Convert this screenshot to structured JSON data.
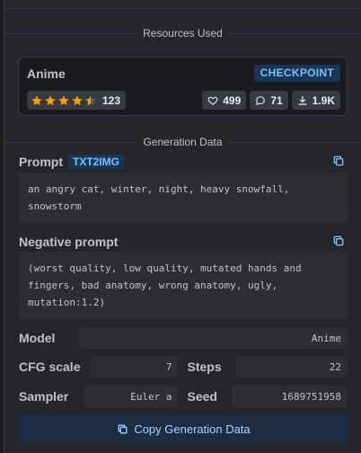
{
  "sections": {
    "resources_title": "Resources Used",
    "generation_title": "Generation Data"
  },
  "resource": {
    "name": "Anime",
    "type_badge": "CHECKPOINT",
    "rating": 4.5,
    "rating_count": "123",
    "likes": "499",
    "comments": "71",
    "downloads": "1.9K"
  },
  "prompt": {
    "label": "Prompt",
    "badge": "TXT2IMG",
    "text": "an angry cat, winter, night, heavy snowfall,\nsnowstorm"
  },
  "negative_prompt": {
    "label": "Negative prompt",
    "text": "(worst quality, low quality, mutated hands and\nfingers, bad anatomy, wrong anatomy, ugly,\nmutation:1.2)"
  },
  "params": {
    "model_label": "Model",
    "model_value": "Anime",
    "cfg_label": "CFG scale",
    "cfg_value": "7",
    "steps_label": "Steps",
    "steps_value": "22",
    "sampler_label": "Sampler",
    "sampler_value": "Euler a",
    "seed_label": "Seed",
    "seed_value": "1689751958"
  },
  "copy_button_label": "Copy Generation Data",
  "colors": {
    "accent": "#74c0fc",
    "badge_bg": "#1c3557",
    "star": "#f59f00",
    "panel": "#25262b",
    "field": "#2c2e33"
  },
  "icons": {
    "star": "star-icon",
    "heart": "heart-icon",
    "comment": "comment-icon",
    "download": "download-icon",
    "copy": "copy-icon"
  }
}
